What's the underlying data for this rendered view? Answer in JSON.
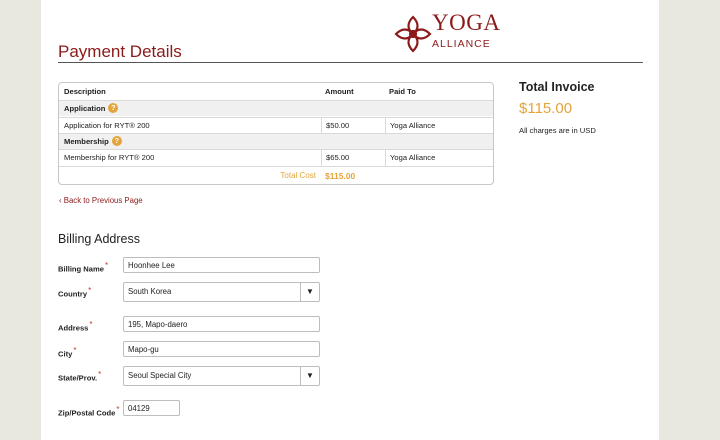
{
  "brand": {
    "logo_word_1": "YOGA",
    "logo_word_2": "ALLIANCE",
    "color": "#8b1a1a"
  },
  "page": {
    "title": "Payment Details"
  },
  "table": {
    "headers": {
      "description": "Description",
      "amount": "Amount",
      "paid_to": "Paid To"
    },
    "sections": [
      {
        "label": "Application",
        "help": "?",
        "row": {
          "description": "Application for RYT® 200",
          "amount": "$50.00",
          "paid_to": "Yoga Alliance"
        }
      },
      {
        "label": "Membership",
        "help": "?",
        "row": {
          "description": "Membership for RYT® 200",
          "amount": "$65.00",
          "paid_to": "Yoga Alliance"
        }
      }
    ],
    "total_label": "Total Cost",
    "total_value": "$115.00"
  },
  "invoice": {
    "title": "Total Invoice",
    "amount": "$115.00",
    "note": "All charges are in USD"
  },
  "back_link": "‹ Back to Previous Page",
  "billing": {
    "title": "Billing Address",
    "required_mark": "*",
    "fields": {
      "name": {
        "label": "Billing Name",
        "value": "Hoonhee Lee"
      },
      "country": {
        "label": "Country",
        "value": "South Korea"
      },
      "address": {
        "label": "Address",
        "value": "195, Mapo-daero"
      },
      "city": {
        "label": "City",
        "value": "Mapo-gu"
      },
      "state": {
        "label": "State/Prov.",
        "value": "Seoul Special City"
      },
      "zip": {
        "label": "Zip/Postal Code",
        "value": "04129"
      }
    },
    "select_arrow": "▼"
  },
  "colors": {
    "accent": "#e5a43b",
    "brand": "#8b1a1a",
    "background": "#e8e8e1"
  }
}
